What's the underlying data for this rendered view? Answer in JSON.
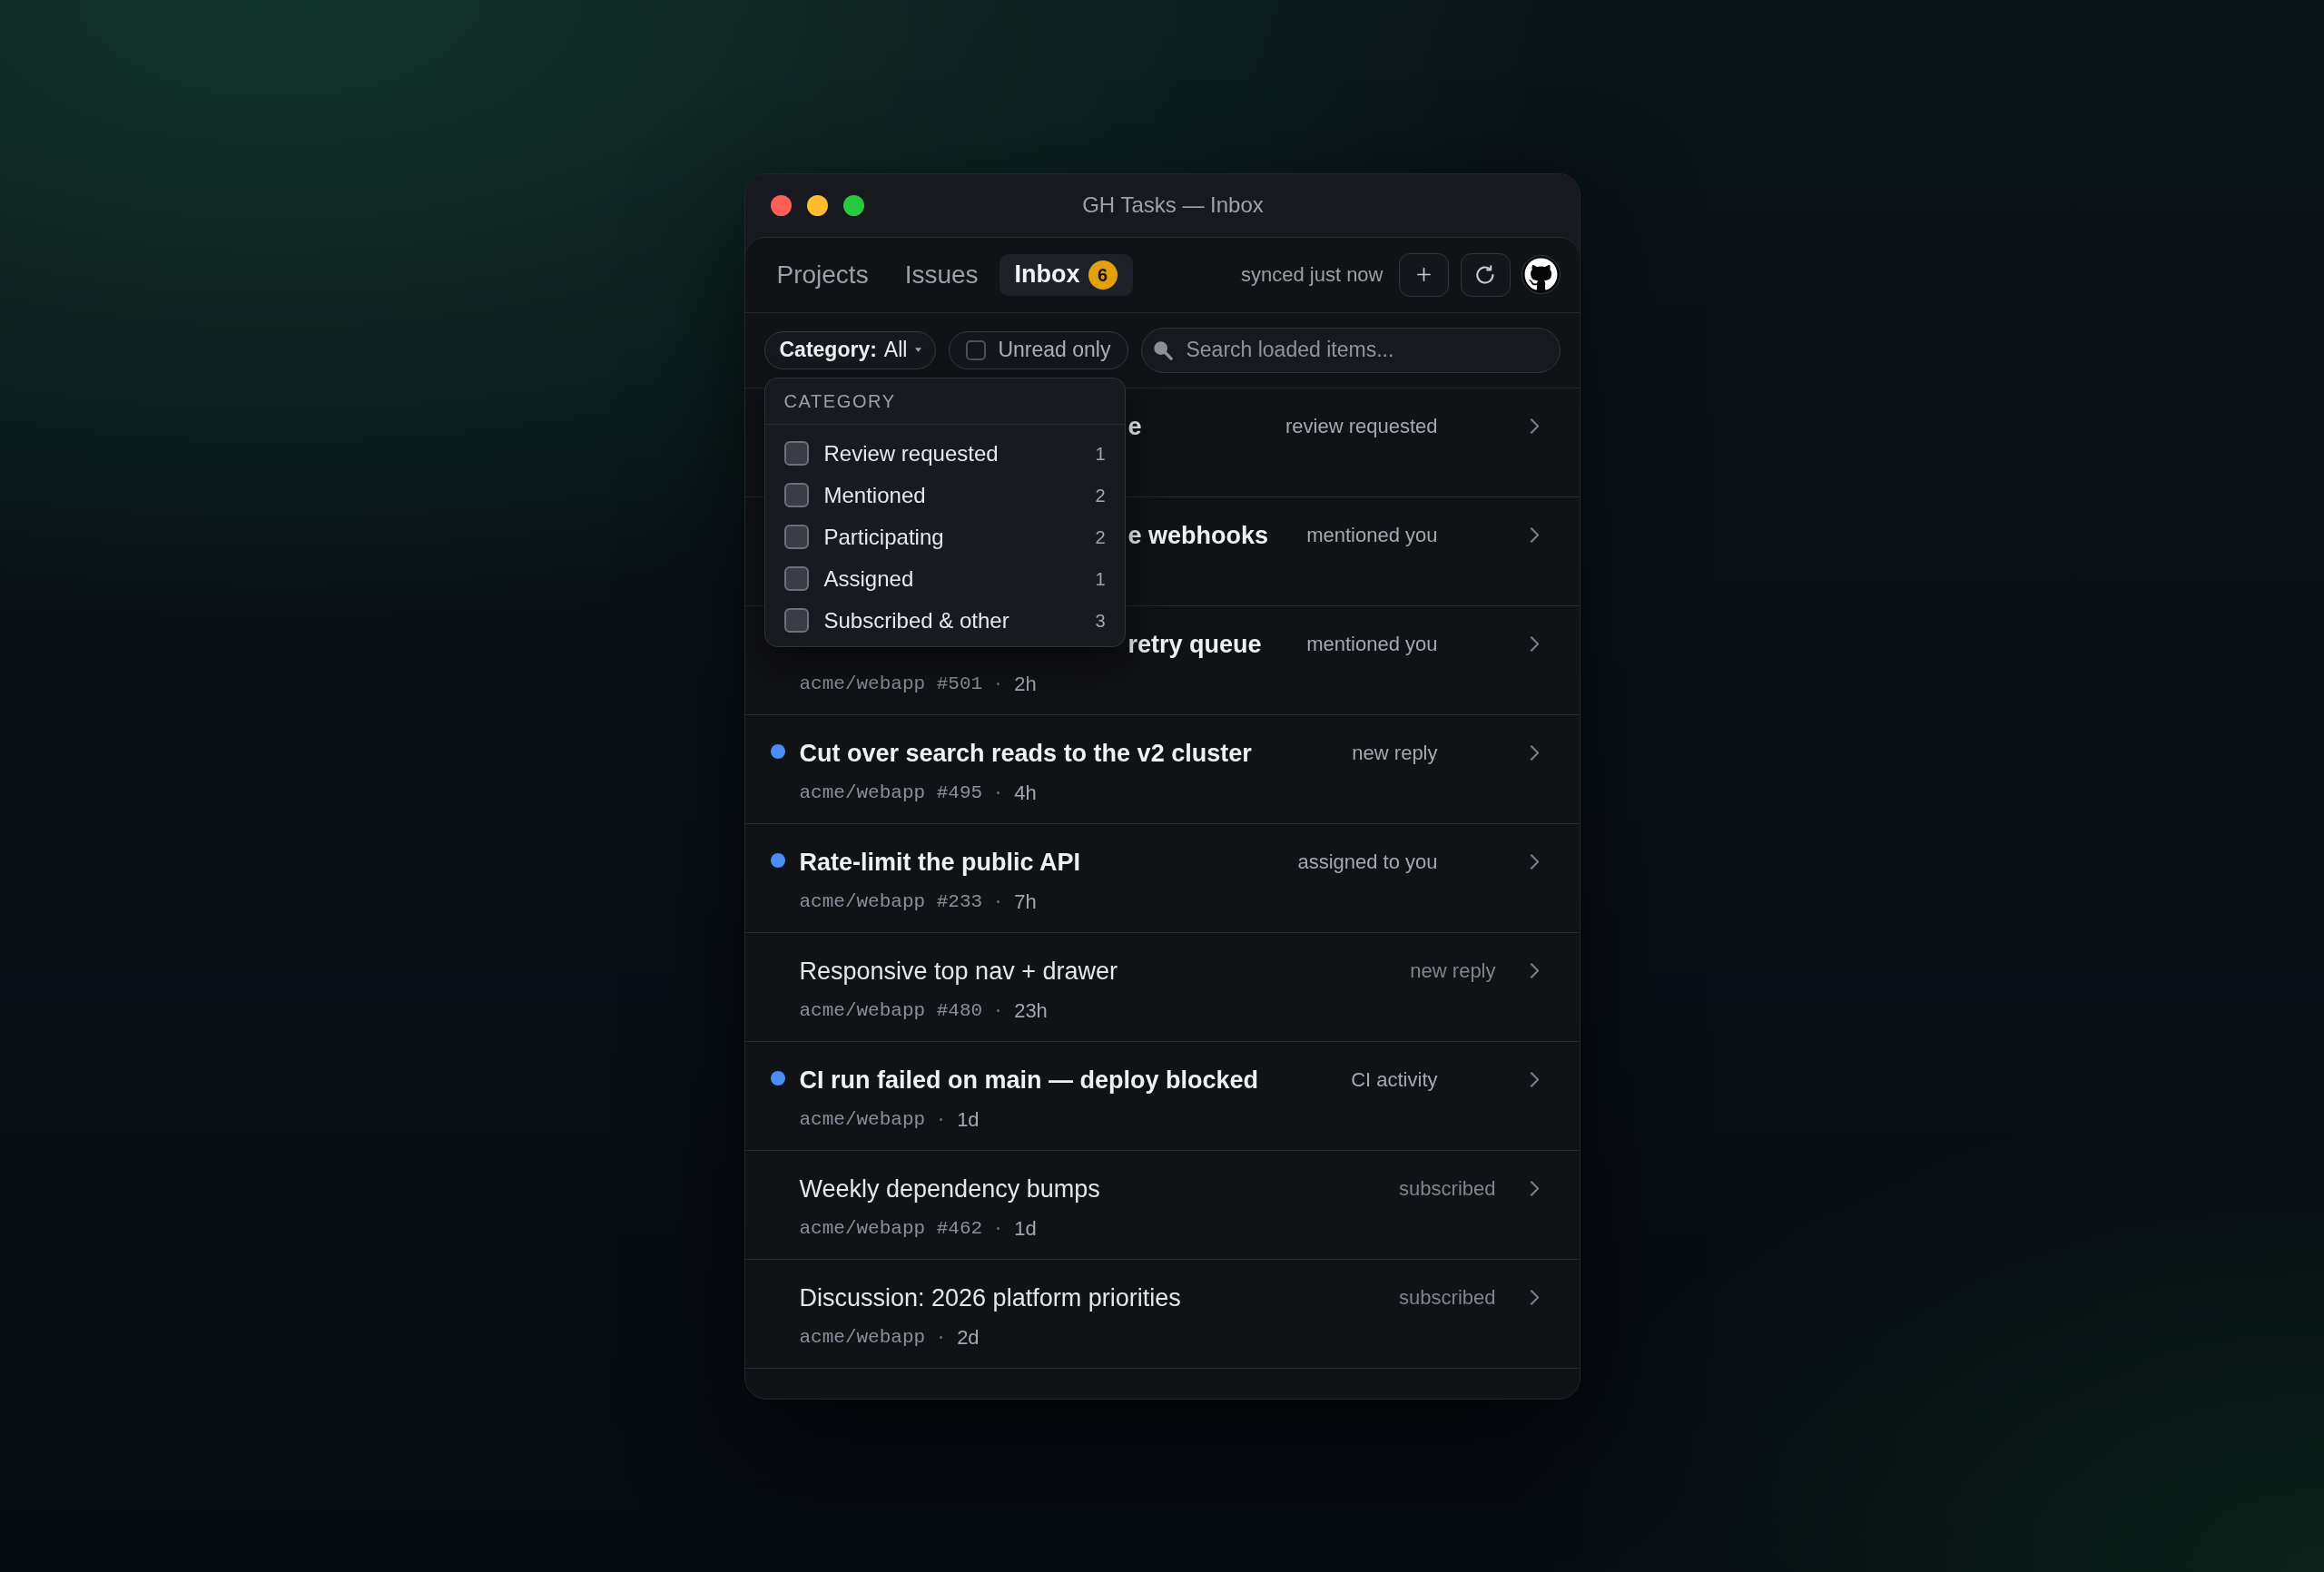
{
  "window": {
    "title": "GH Tasks — Inbox"
  },
  "nav": {
    "tabs": [
      {
        "label": "Projects",
        "selected": false
      },
      {
        "label": "Issues",
        "selected": false
      },
      {
        "label": "Inbox",
        "selected": true,
        "badge": "6"
      }
    ],
    "sync_status": "synced just now"
  },
  "filters": {
    "category": {
      "label": "Category:",
      "value": "All"
    },
    "unread_only": {
      "label": "Unread only",
      "checked": false
    },
    "search": {
      "placeholder": "Search loaded items..."
    }
  },
  "category_menu": {
    "open": true,
    "heading": "CATEGORY",
    "options": [
      {
        "label": "Review requested",
        "count": "1",
        "checked": false
      },
      {
        "label": "Mentioned",
        "count": "2",
        "checked": false
      },
      {
        "label": "Participating",
        "count": "2",
        "checked": false
      },
      {
        "label": "Assigned",
        "count": "1",
        "checked": false
      },
      {
        "label": "Subscribed & other",
        "count": "3",
        "checked": false
      }
    ]
  },
  "items": [
    {
      "kind": "partial",
      "title": "e",
      "unread": true,
      "reason": "review requested"
    },
    {
      "kind": "partial",
      "title": "e webhooks",
      "unread": true,
      "reason": "mentioned you"
    },
    {
      "kind": "partial",
      "title": "retry queue",
      "unread": true,
      "reason": "mentioned you",
      "meta": {
        "ref": "acme/webapp #501",
        "age": "2h"
      }
    },
    {
      "kind": "full",
      "title": "Cut over search reads to the v2 cluster",
      "unread": true,
      "reason": "new reply",
      "meta": {
        "ref": "acme/webapp #495",
        "age": "4h"
      }
    },
    {
      "kind": "full",
      "title": "Rate-limit the public API",
      "unread": true,
      "reason": "assigned to you",
      "meta": {
        "ref": "acme/webapp #233",
        "age": "7h"
      }
    },
    {
      "kind": "full",
      "title": "Responsive top nav + drawer",
      "unread": false,
      "reason": "new reply",
      "meta": {
        "ref": "acme/webapp #480",
        "age": "23h"
      }
    },
    {
      "kind": "full",
      "title": "CI run failed on main — deploy blocked",
      "unread": true,
      "reason": "CI activity",
      "meta": {
        "ref": "acme/webapp",
        "age": "1d"
      }
    },
    {
      "kind": "full",
      "title": "Weekly dependency bumps",
      "unread": false,
      "reason": "subscribed",
      "meta": {
        "ref": "acme/webapp #462",
        "age": "1d"
      }
    },
    {
      "kind": "full",
      "title": "Discussion: 2026 platform priorities",
      "unread": false,
      "reason": "subscribed",
      "meta": {
        "ref": "acme/webapp",
        "age": "2d"
      }
    }
  ]
}
